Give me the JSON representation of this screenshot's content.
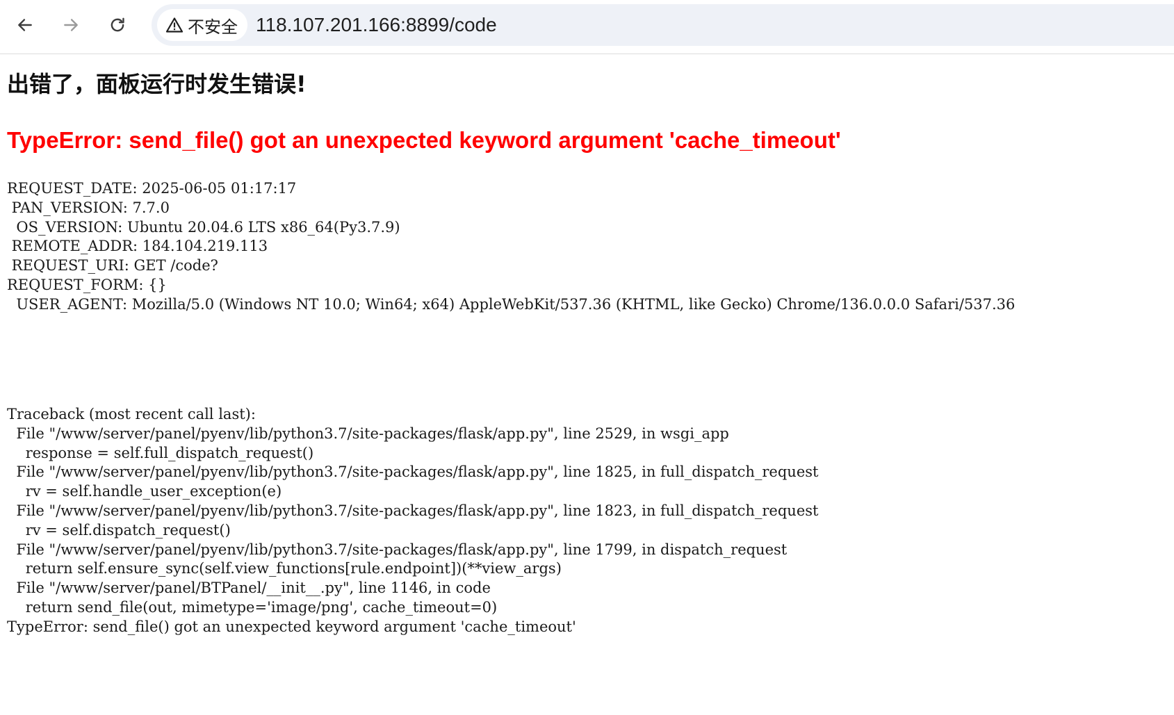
{
  "browser": {
    "security_label": "不安全",
    "url": "118.107.201.166:8899/code",
    "icons": {
      "back": "arrow-left-icon",
      "forward": "arrow-right-icon",
      "reload": "reload-icon",
      "warning": "warning-triangle-icon"
    }
  },
  "page": {
    "title": "出错了，面板运行时发生错误!",
    "error_heading": "TypeError: send_file() got an unexpected keyword argument 'cache_timeout'",
    "error_color": "#ff0000",
    "info_lines": [
      "REQUEST_DATE: 2025-06-05 01:17:17",
      " PAN_VERSION: 7.7.0",
      "  OS_VERSION: Ubuntu 20.04.6 LTS x86_64(Py3.7.9)",
      " REMOTE_ADDR: 184.104.219.113",
      " REQUEST_URI: GET /code?",
      "REQUEST_FORM: {}",
      "  USER_AGENT: Mozilla/5.0 (Windows NT 10.0; Win64; x64) AppleWebKit/537.36 (KHTML, like Gecko) Chrome/136.0.0.0 Safari/537.36"
    ],
    "traceback_lines": [
      "Traceback (most recent call last):",
      "  File \"/www/server/panel/pyenv/lib/python3.7/site-packages/flask/app.py\", line 2529, in wsgi_app",
      "    response = self.full_dispatch_request()",
      "  File \"/www/server/panel/pyenv/lib/python3.7/site-packages/flask/app.py\", line 1825, in full_dispatch_request",
      "    rv = self.handle_user_exception(e)",
      "  File \"/www/server/panel/pyenv/lib/python3.7/site-packages/flask/app.py\", line 1823, in full_dispatch_request",
      "    rv = self.dispatch_request()",
      "  File \"/www/server/panel/pyenv/lib/python3.7/site-packages/flask/app.py\", line 1799, in dispatch_request",
      "    return self.ensure_sync(self.view_functions[rule.endpoint])(**view_args)",
      "  File \"/www/server/panel/BTPanel/__init__.py\", line 1146, in code",
      "    return send_file(out, mimetype='image/png', cache_timeout=0)",
      "TypeError: send_file() got an unexpected keyword argument 'cache_timeout'"
    ]
  }
}
